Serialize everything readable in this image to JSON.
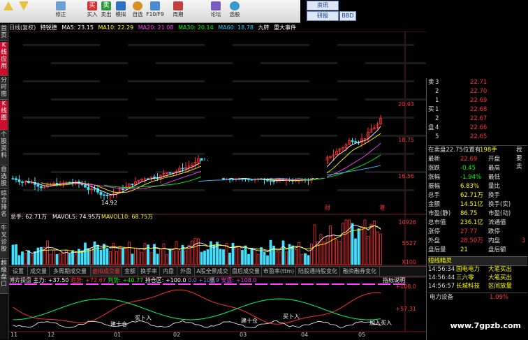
{
  "toolbar": {
    "buttons": [
      {
        "label": "",
        "icon": "up-arrow-icon"
      },
      {
        "label": "",
        "icon": "down-arrow-icon"
      },
      {
        "label": "修正",
        "icon": "edit-icon"
      },
      {
        "label": "买入",
        "icon": "buy-icon"
      },
      {
        "label": "卖出",
        "icon": "sell-icon"
      },
      {
        "label": "模拟",
        "icon": "simulate-icon"
      },
      {
        "label": "自选",
        "icon": "favorite-icon"
      },
      {
        "label": "F10/F9",
        "icon": "f10-icon"
      },
      {
        "label": "周期",
        "icon": "period-icon"
      },
      {
        "label": "论坛",
        "icon": "forum-icon"
      },
      {
        "label": "选股",
        "icon": "stock-select-icon"
      }
    ],
    "right_buttons": [
      "资讯",
      "研报",
      "BBD"
    ]
  },
  "sidebar": {
    "items": [
      "首页",
      "K线应用",
      "分时图",
      "K线图",
      "个股资料",
      "自选股",
      "综合排名",
      "牛叉诊股",
      "超级盘口"
    ]
  },
  "chart_header": {
    "mode": "日线(复权)",
    "indicator": "特锐德",
    "ma5": "MA5: 23.15",
    "ma10": "MA10: 22.29",
    "ma20": "MA20: 21.08",
    "ma30": "MA30: 20.14",
    "ma60": "MA60: 18.78",
    "right1": "九转",
    "right2": "重大事件"
  },
  "price_axis": [
    "20.93",
    "18.75",
    "16.56"
  ],
  "low_label": "14.92",
  "event_labels": [
    "财",
    "港"
  ],
  "volume_header": {
    "vol": "总手: 62.71万",
    "mavol5": "MAVOL5: 74.95万",
    "mavol10": "MAVOL10: 68.75万"
  },
  "volume_axis": [
    "10926",
    "5527",
    "X100"
  ],
  "tabs": [
    "设置",
    "成交量",
    "多周期成交量",
    "虚拟成交量",
    "金额",
    "换手率",
    "内盘",
    "外盘",
    "A股全景成交量",
    "盘后成交量",
    "市盈率(ttm)",
    "陆股通持股变化",
    "融资融券变化"
  ],
  "active_tab": 3,
  "indicator_header": {
    "name": "博弈操盘",
    "zl": "主力: +37.50",
    "qs": "趋势: +72.67",
    "pd": "判势: +40.77",
    "cc": "持仓区: +100.0",
    "ox": "0.0",
    "mx": "+107.9",
    "tb": "安盘: +108.0",
    "help": "指标说明"
  },
  "indicator_axis": [
    "+108.0",
    "+57.31"
  ],
  "indicator_labels": [
    "建十仓",
    "买卜入",
    "建十仓",
    "买卜入",
    "加入买入"
  ],
  "time_axis": [
    "11",
    "12",
    "01",
    "02",
    "03",
    "04",
    "05"
  ],
  "orderbook": [
    {
      "side": "卖",
      "level": "3",
      "price": "22.71"
    },
    {
      "side": "",
      "level": "2",
      "price": "22.70"
    },
    {
      "side": "",
      "level": "1",
      "price": "22.69"
    },
    {
      "side": "买",
      "level": "1",
      "price": "22.68"
    },
    {
      "side": "",
      "level": "2",
      "price": "22.67"
    },
    {
      "side": "盘",
      "level": "4",
      "price": "22.66"
    },
    {
      "side": "",
      "level": "5",
      "price": "22.65"
    }
  ],
  "order_status": {
    "text1": "在卖盘22.75位置有",
    "text2": "198手",
    "link": "我要卖"
  },
  "quote": [
    {
      "l1": "最新",
      "v1": "22.69",
      "c1": "#f33",
      "l2": "开盘",
      "v2": ""
    },
    {
      "l1": "涨跌",
      "v1": "-0.45",
      "c1": "#0f0",
      "l2": "最高",
      "v2": ""
    },
    {
      "l1": "涨幅",
      "v1": "-1.94%",
      "c1": "#0f0",
      "l2": "最低",
      "v2": ""
    },
    {
      "l1": "振幅",
      "v1": "6.83%",
      "c1": "#ff0",
      "l2": "量比",
      "v2": ""
    },
    {
      "l1": "总手",
      "v1": "62.71万",
      "c1": "#ff0",
      "l2": "换手",
      "v2": ""
    },
    {
      "l1": "金额",
      "v1": "14.51亿",
      "c1": "#ff0",
      "l2": "换手(实)",
      "v2": ""
    },
    {
      "l1": "市盈(静)",
      "v1": "86.75",
      "c1": "#ff0",
      "l2": "市盈(动)",
      "v2": ""
    },
    {
      "l1": "总市值",
      "v1": "236.1亿",
      "c1": "#ff0",
      "l2": "流通值",
      "v2": ""
    },
    {
      "l1": "涨停",
      "v1": "27.77",
      "c1": "#f33",
      "l2": "跌停",
      "v2": ""
    },
    {
      "l1": "外盘",
      "v1": "28.50万",
      "c1": "#f33",
      "l2": "内盘",
      "v2": "3"
    },
    {
      "l1": "盘后量",
      "v1": "21",
      "c1": "#ff0",
      "l2": "盘后额",
      "v2": ""
    }
  ],
  "spirit_title": "短线精灵",
  "spirit": [
    {
      "time": "14:56:34",
      "name": "国电电力",
      "act": "大笔买出"
    },
    {
      "time": "14:56:44",
      "name": "三六零",
      "act": "大笔买出"
    },
    {
      "time": "14:56:57",
      "name": "长城科技",
      "act": "区间放量"
    }
  ],
  "sector": {
    "name": "电力设备",
    "value": "1.09%"
  },
  "watermark": "www.7gpzb.com"
}
